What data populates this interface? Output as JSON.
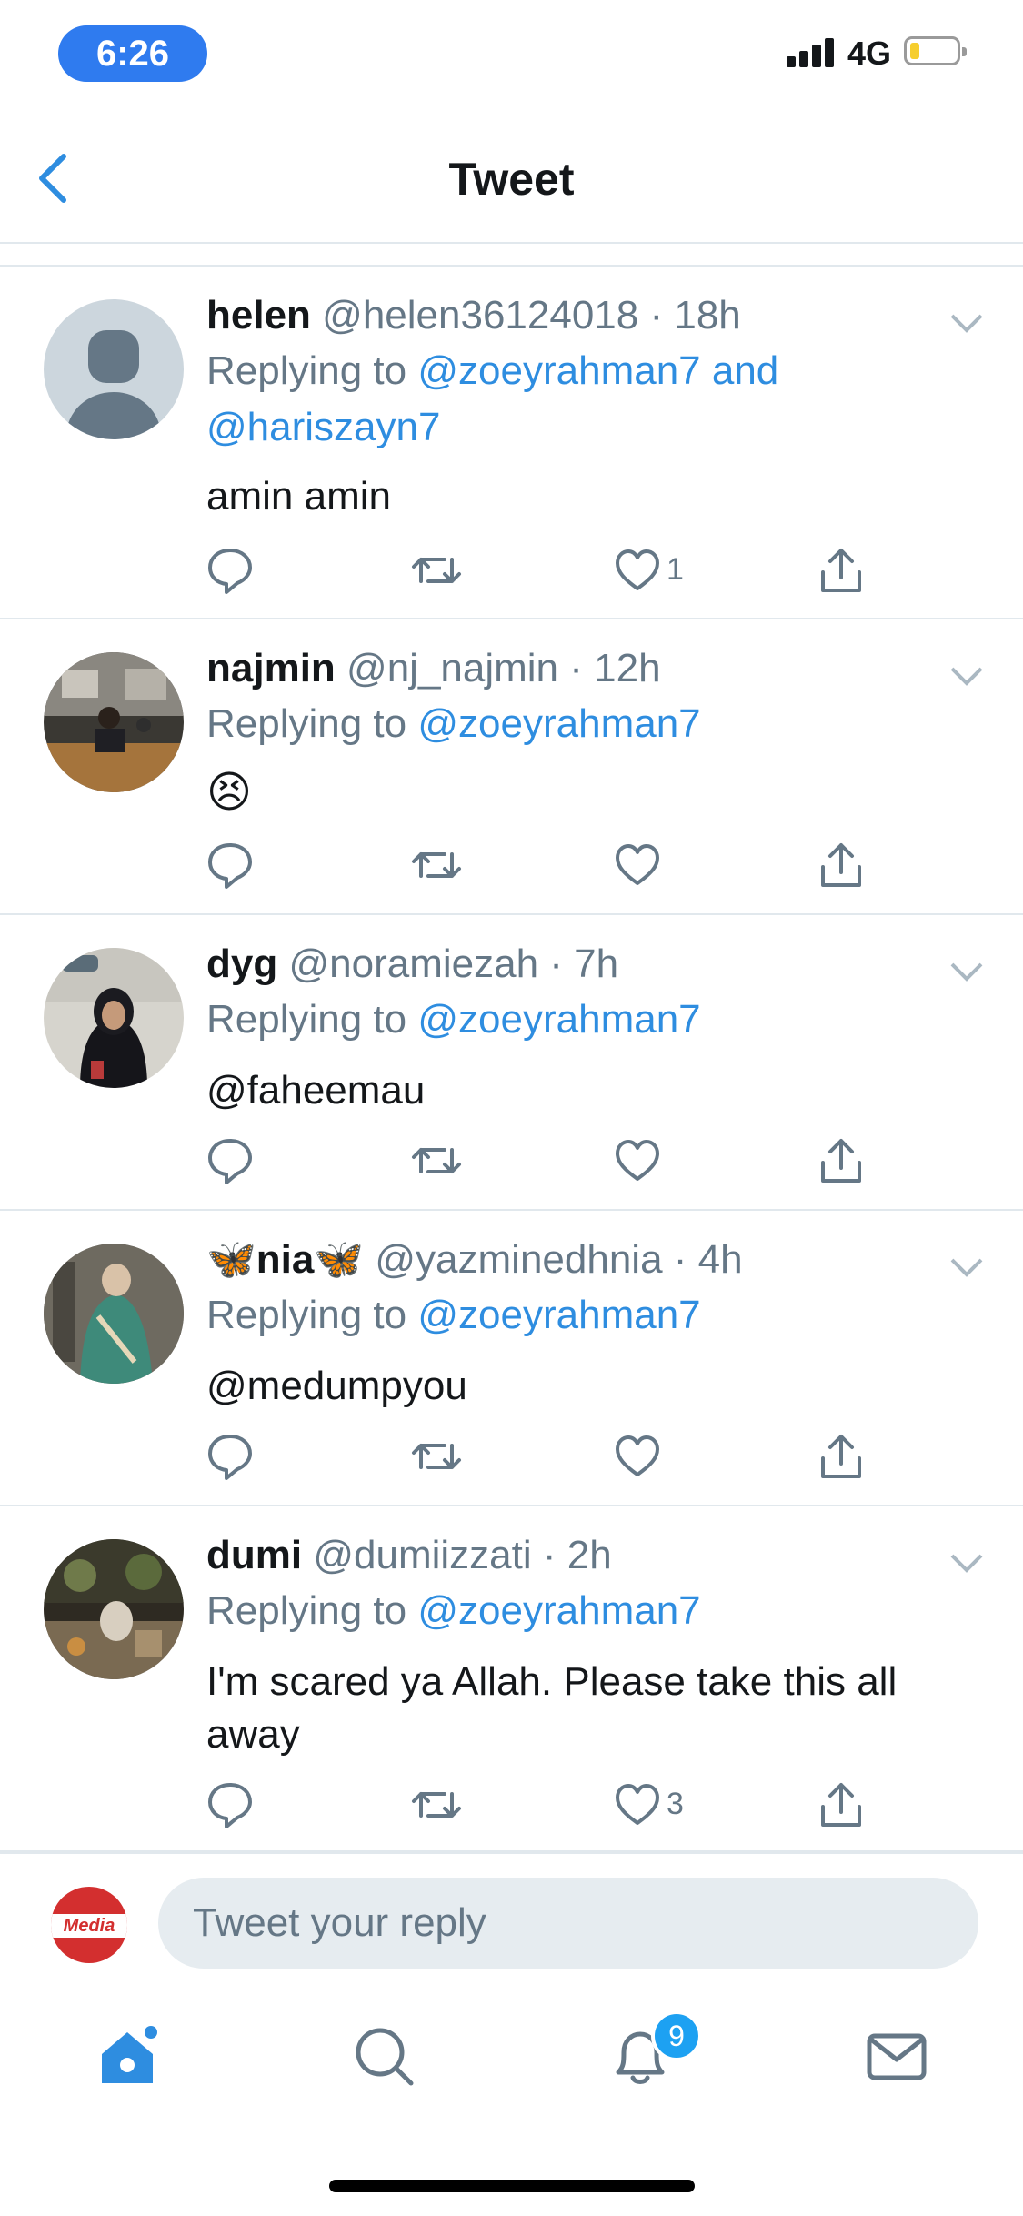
{
  "status_bar": {
    "time": "6:26",
    "network": "4G"
  },
  "header": {
    "title": "Tweet",
    "back_icon": "chevron-left-icon"
  },
  "colors": {
    "accent": "#2e8de0",
    "secondary_text": "#657786",
    "divider": "#e1e8ed",
    "status_pill": "#2f7bef"
  },
  "tweets": [
    {
      "name": "helen",
      "handle": "@helen36124018",
      "separator": "·",
      "time": "18h",
      "replying_prefix": "Replying to",
      "replying_links": "@zoeyrahman7 and @hariszayn7",
      "body": "amin amin",
      "like_count": "1",
      "retweet_count": "",
      "reply_count": ""
    },
    {
      "name": "najmin",
      "handle": "@nj_najmin",
      "separator": "·",
      "time": "12h",
      "replying_prefix": "Replying to",
      "replying_links": "@zoeyrahman7",
      "body": "😣",
      "like_count": "",
      "retweet_count": "",
      "reply_count": ""
    },
    {
      "name": "dyg",
      "handle": "@noramiezah",
      "separator": "·",
      "time": "7h",
      "replying_prefix": "Replying to",
      "replying_links": "@zoeyrahman7",
      "body": "@faheemau",
      "like_count": "",
      "retweet_count": "",
      "reply_count": ""
    },
    {
      "name": "🦋nia🦋",
      "handle": "@yazminedhnia",
      "separator": "·",
      "time": "4h",
      "replying_prefix": "Replying to",
      "replying_links": "@zoeyrahman7",
      "body": "@medumpyou",
      "like_count": "",
      "retweet_count": "",
      "reply_count": ""
    },
    {
      "name": "dumi",
      "handle": "@dumiizzati",
      "separator": "·",
      "time": "2h",
      "replying_prefix": "Replying to",
      "replying_links": "@zoeyrahman7",
      "body": "I'm scared ya Allah. Please take this all away",
      "like_count": "3",
      "retweet_count": "",
      "reply_count": ""
    }
  ],
  "composer": {
    "placeholder": "Tweet your reply",
    "avatar_text": "Media"
  },
  "tab_bar": {
    "items": [
      "home-icon",
      "search-icon",
      "notifications-icon",
      "messages-icon"
    ],
    "notifications_badge": "9",
    "active": "home"
  }
}
